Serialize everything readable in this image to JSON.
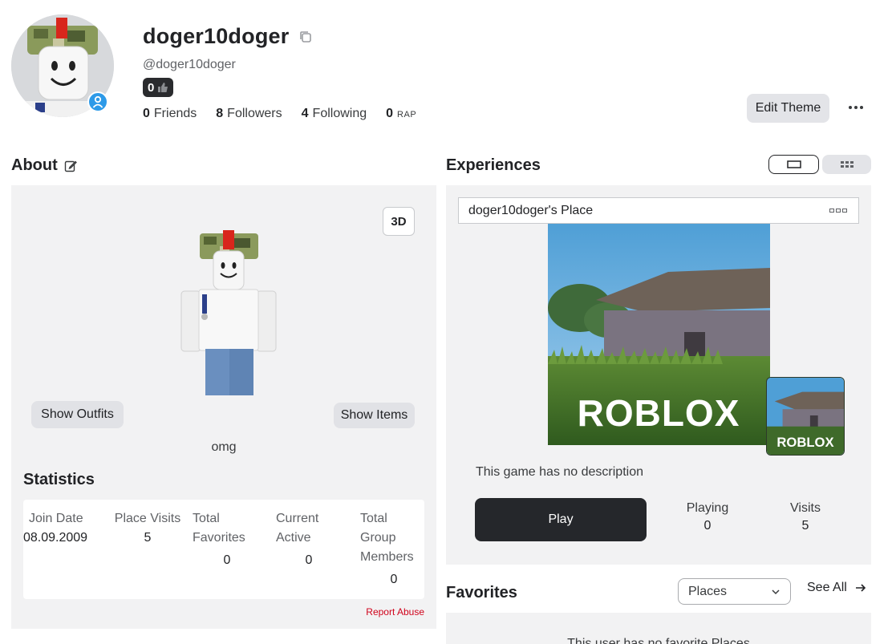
{
  "profile": {
    "display_name": "doger10doger",
    "username": "@doger10doger",
    "badge_count": "0",
    "stats": [
      {
        "value": "0",
        "label": "Friends"
      },
      {
        "value": "8",
        "label": "Followers"
      },
      {
        "value": "4",
        "label": "Following"
      },
      {
        "value": "0",
        "label": "RAP"
      }
    ],
    "edit_theme_label": "Edit Theme"
  },
  "about": {
    "title": "About",
    "btn_3d": "3D",
    "show_outfits": "Show Outfits",
    "show_items": "Show Items",
    "bio": "omg",
    "statistics_title": "Statistics",
    "statistics": {
      "join_date_label": "Join Date",
      "join_date": "08.09.2009",
      "place_visits_label": "Place Visits",
      "place_visits": "5",
      "total_favorites_label": "Total Favorites",
      "total_favorites": "0",
      "current_active_label": "Current Active",
      "current_active": "0",
      "group_members_label": "Total Group Members",
      "group_members": "0"
    },
    "report_abuse": "Report Abuse"
  },
  "experiences": {
    "title": "Experiences",
    "selected_place": "doger10doger's Place",
    "thumbnail_logo": "ROBLOX",
    "description": "This game has no description",
    "play_label": "Play",
    "playing_label": "Playing",
    "playing_value": "0",
    "visits_label": "Visits",
    "visits_value": "5"
  },
  "favorites": {
    "title": "Favorites",
    "filter_value": "Places",
    "see_all": "See All",
    "empty_text": "This user has no favorite Places"
  },
  "colors": {
    "accent_blue": "#2d9ae8",
    "dark_button": "#25272b",
    "panel_bg": "#f2f2f3",
    "report_red": "#d0021b"
  }
}
